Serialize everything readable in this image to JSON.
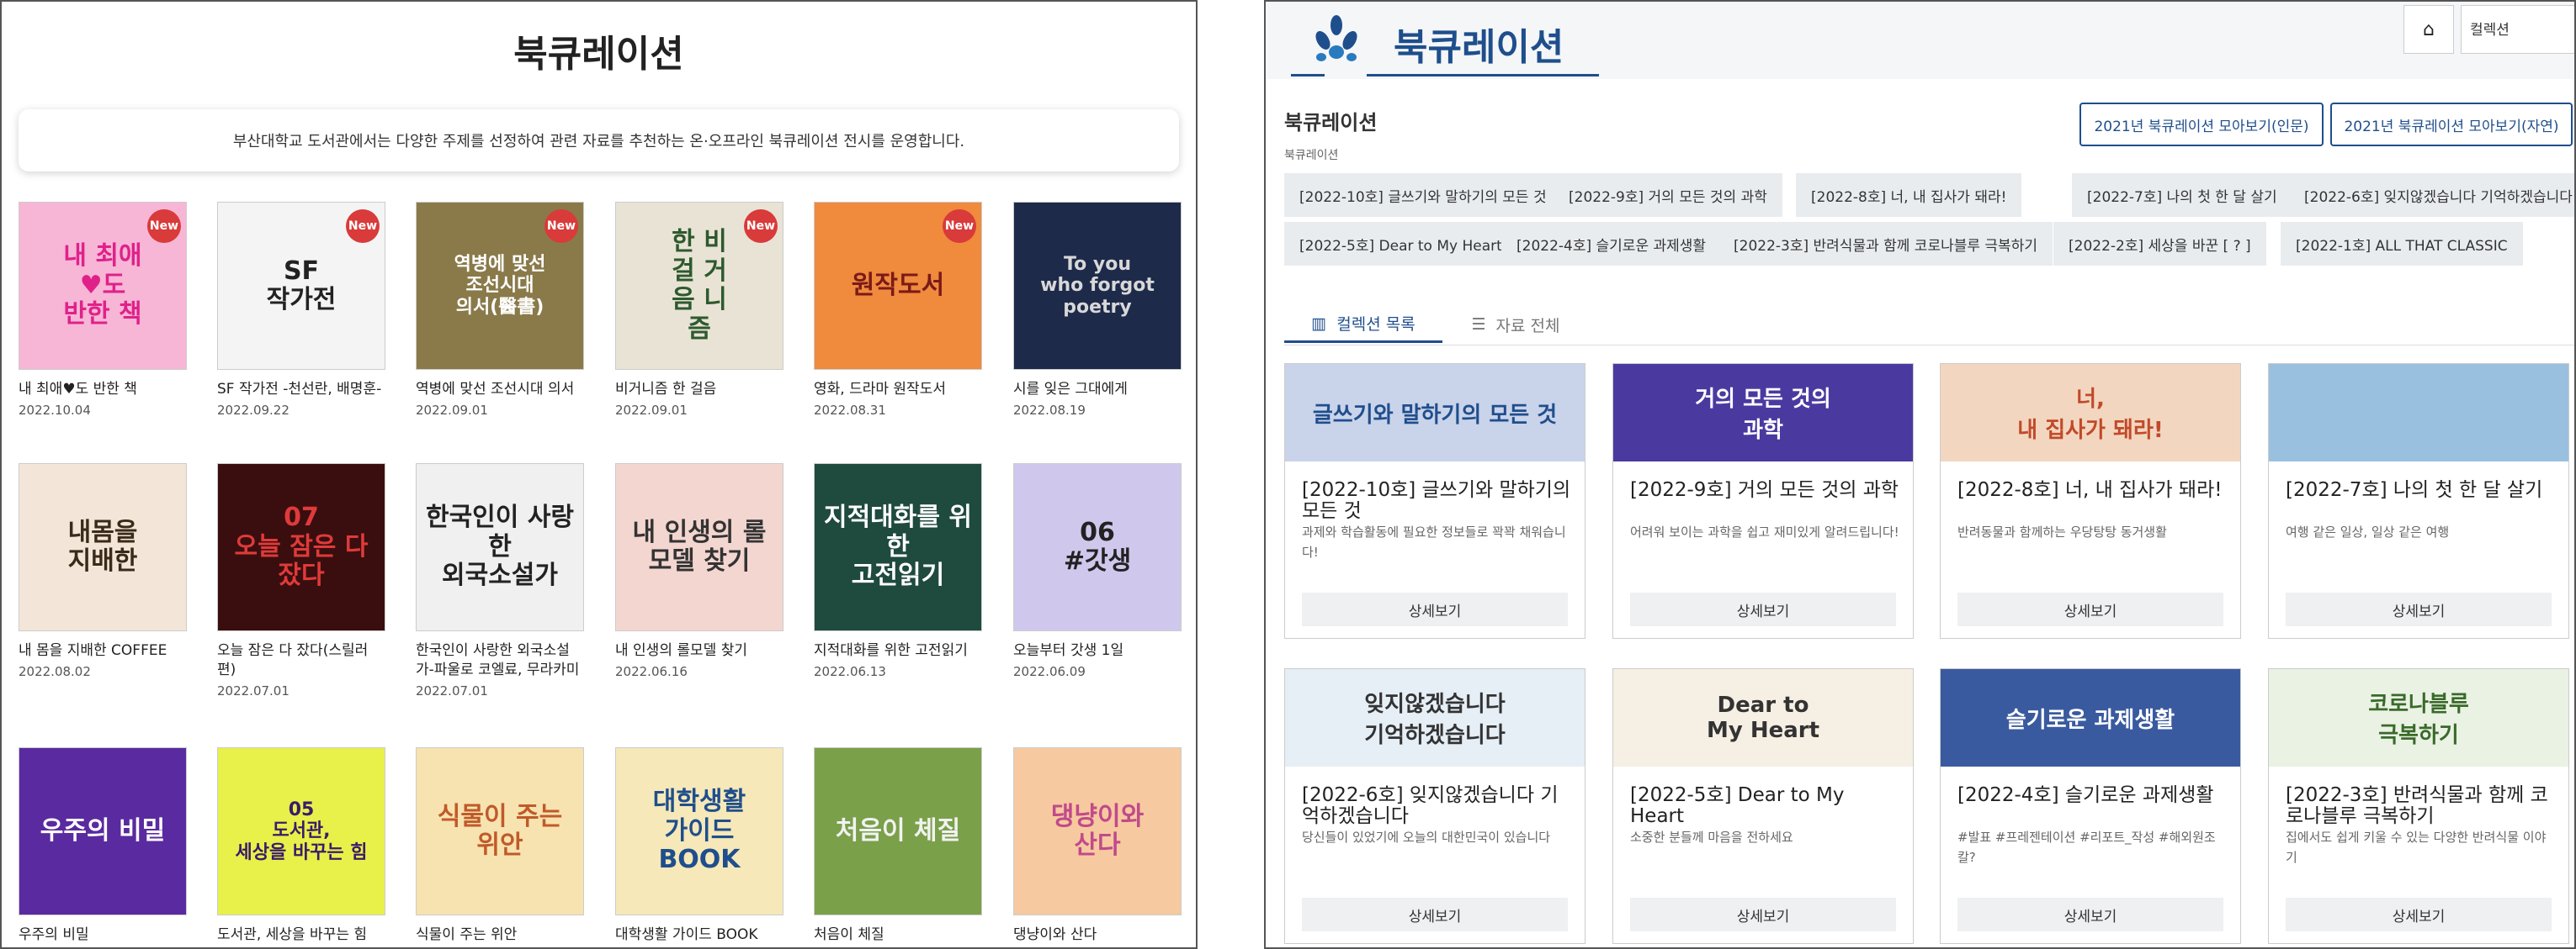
{
  "left": {
    "title": "북큐레이션",
    "intro": "부산대학교 도서관에서는 다양한 주제를 선정하여 관련 자료를 추천하는 온·오프라인 북큐레이션 전시를 운영합니다.",
    "new_label": "New",
    "items": [
      {
        "title": "내 최애♥도 반한 책",
        "date": "2022.10.04",
        "cover": "내 최애\n♥도\n반한 책",
        "bg": "#f7b6d6",
        "fg": "#e0218a"
      },
      {
        "title": "SF 작가전 -천선란, 배명훈-",
        "date": "2022.09.22",
        "cover": "SF\n작가전",
        "bg": "#f4f4f4",
        "fg": "#222"
      },
      {
        "title": "역병에 맞선 조선시대 의서",
        "date": "2022.09.01",
        "cover": "역병에 맞선\n조선시대\n의서(醫書)",
        "bg": "#8a7a4a",
        "fg": "#fff"
      },
      {
        "title": "비거니즘 한 걸음",
        "date": "2022.09.01",
        "cover": "한 비\n걸 거\n음 니\n즘",
        "bg": "#e9e3d6",
        "fg": "#2d5a2d"
      },
      {
        "title": "영화, 드라마 원작도서",
        "date": "2022.08.31",
        "cover": "원작도서",
        "bg": "#f08a3c",
        "fg": "#7a1a1a"
      },
      {
        "title": "시를 잊은 그대에게",
        "date": "2022.08.19",
        "cover": "To you\nwho forgot poetry",
        "bg": "#1e2a4a",
        "fg": "#d8d8d8"
      },
      {
        "title": "내 몸을 지배한 COFFEE",
        "date": "2022.08.02",
        "cover": "내몸을\n지배한",
        "bg": "#f3e6d8",
        "fg": "#3a2a1a"
      },
      {
        "title": "오늘 잠은 다 잤다(스릴러편)",
        "date": "2022.07.01",
        "cover": "07\n오늘 잠은 다 잤다",
        "bg": "#3a0e0e",
        "fg": "#e03a3a"
      },
      {
        "title": "한국인이 사랑한 외국소설가-파울로 코엘료, 무라카미 하루키",
        "date": "2022.07.01",
        "cover": "한국인이 사랑한\n외국소설가",
        "bg": "#f0f0f0",
        "fg": "#222"
      },
      {
        "title": "내 인생의 롤모델 찾기",
        "date": "2022.06.16",
        "cover": "내 인생의 롤모델 찾기",
        "bg": "#f3d6d0",
        "fg": "#333"
      },
      {
        "title": "지적대화를 위한 고전읽기",
        "date": "2022.06.13",
        "cover": "지적대화를 위한\n고전읽기",
        "bg": "#1f4a3e",
        "fg": "#fff"
      },
      {
        "title": "오늘부터 갓생 1일",
        "date": "2022.06.09",
        "cover": "06\n#갓생",
        "bg": "#cfc8ec",
        "fg": "#222"
      },
      {
        "title": "우주의 비밀",
        "date": "",
        "cover": "우주의 비밀",
        "bg": "#5a2aa0",
        "fg": "#fff"
      },
      {
        "title": "도서관, 세상을 바꾸는 힘",
        "date": "",
        "cover": "05\n도서관,\n세상을 바꾸는 힘",
        "bg": "#e8f04a",
        "fg": "#3a1a6a"
      },
      {
        "title": "식물이 주는 위안",
        "date": "",
        "cover": "식물이 주는 위안",
        "bg": "#f7e3b0",
        "fg": "#c05a2a"
      },
      {
        "title": "대학생활 가이드 BOOK",
        "date": "",
        "cover": "대학생활\n가이드 BOOK",
        "bg": "#f6e8b8",
        "fg": "#1f4e8c"
      },
      {
        "title": "처음이 체질",
        "date": "",
        "cover": "처음이 체질",
        "bg": "#7aa04a",
        "fg": "#f2f2f2"
      },
      {
        "title": "댕냥이와 산다",
        "date": "",
        "cover": "댕냥이와\n산다",
        "bg": "#f7c9a0",
        "fg": "#c04a8a"
      }
    ]
  },
  "right": {
    "brand": "북큐레이션",
    "search_select": "컬렉션",
    "page_title": "북큐레이션",
    "breadcrumb": "북큐레이션",
    "btn_humanities": "2021년 북큐레이션 모아보기(인문)",
    "btn_science": "2021년 북큐레이션 모아보기(자연)",
    "chips": [
      "[2022-10호] 글쓰기와 말하기의 모든 것",
      "[2022-9호] 거의 모든 것의 과학",
      "[2022-8호] 너, 내 집사가 돼라!",
      "[2022-7호] 나의 첫 한 달 살기",
      "[2022-6호] 잊지않겠습니다 기억하겠습니다",
      "[2022-5호] Dear to My Heart",
      "[2022-4호] 슬기로운 과제생활",
      "[2022-3호] 반려식물과 함께 코로나블루 극복하기",
      "[2022-2호] 세상을 바꾼 [ ? ]",
      "[2022-1호] ALL THAT CLASSIC"
    ],
    "tab_collection": "컬렉션 목록",
    "tab_all": "자료 전체",
    "detail_label": "상세보기",
    "cards": [
      {
        "title": "[2022-10호] 글쓰기와 말하기의 모든 것",
        "desc": "과제와 학습활동에 필요한 정보들로 꽉꽉 채워습니다!",
        "banner": "글쓰기와 말하기의 모든 것",
        "bg": "#c9d3ea",
        "fg": "#1f4e8c"
      },
      {
        "title": "[2022-9호] 거의 모든 것의 과학",
        "desc": "어려워 보이는 과학을 쉽고 재미있게 알려드립니다!",
        "banner": "거의 모든 것의\n과학",
        "bg": "#4a3aa0",
        "fg": "#fff"
      },
      {
        "title": "[2022-8호] 너, 내 집사가 돼라!",
        "desc": "반려동물과 함께하는 우당탕탕 동거생활",
        "banner": "너,\n내 집사가 돼라!",
        "bg": "#f3d6c0",
        "fg": "#c04a2a"
      },
      {
        "title": "[2022-7호] 나의 첫 한 달 살기",
        "desc": "여행 같은 일상, 일상 같은 여행",
        "banner": "",
        "bg": "#9ac0e0",
        "fg": "#fff"
      },
      {
        "title": "[2022-6호] 잊지않겠습니다 기억하겠습니다",
        "desc": "당신들이 있었기에 오늘의 대한민국이 있습니다",
        "banner": "잊지않겠습니다\n기억하겠습니다",
        "bg": "#e6eef6",
        "fg": "#333"
      },
      {
        "title": "[2022-5호] Dear to My Heart",
        "desc": "소중한 분들께 마음을 전하세요",
        "banner": "Dear to\nMy Heart",
        "bg": "#f6efe4",
        "fg": "#333"
      },
      {
        "title": "[2022-4호] 슬기로운 과제생활",
        "desc": "#발표 #프레젠테이션 #리포트_작성 #해외원조칼?",
        "banner": "슬기로운 과제생활",
        "bg": "#3a5aa0",
        "fg": "#fff"
      },
      {
        "title": "[2022-3호] 반려식물과 함께 코로나블루 극복하기",
        "desc": "집에서도 쉽게 키울 수 있는 다양한 반려식물 이야기",
        "banner": "코로나블루\n극복하기",
        "bg": "#eaf2e4",
        "fg": "#3a6a2a"
      }
    ]
  }
}
